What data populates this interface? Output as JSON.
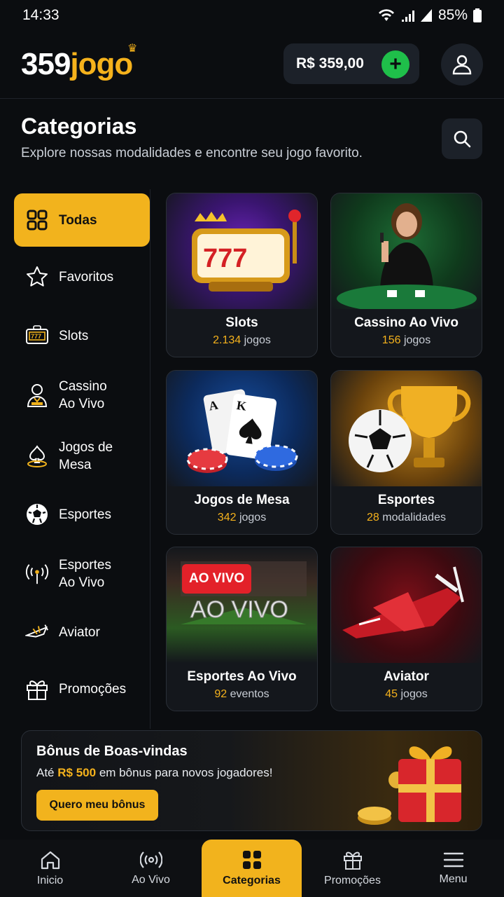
{
  "status": {
    "time": "14:33",
    "battery": "85%"
  },
  "header": {
    "logo_num": "359",
    "logo_word": "jogo",
    "balance": "R$ 359,00"
  },
  "page": {
    "title": "Categorias",
    "subtitle": "Explore nossas modalidades e encontre seu jogo favorito."
  },
  "sidebar": {
    "items": [
      {
        "label": "Todas",
        "icon": "grid-icon"
      },
      {
        "label": "Favoritos",
        "icon": "star-icon"
      },
      {
        "label": "Slots",
        "icon": "slot-machine-icon"
      },
      {
        "label": "Cassino\nAo Vivo",
        "icon": "dealer-icon"
      },
      {
        "label": "Jogos de\nMesa",
        "icon": "spade-chip-icon"
      },
      {
        "label": "Esportes",
        "icon": "soccer-ball-icon"
      },
      {
        "label": "Esportes\nAo Vivo",
        "icon": "broadcast-icon"
      },
      {
        "label": "Aviator",
        "icon": "plane-icon"
      },
      {
        "label": "Promoções",
        "icon": "gift-icon"
      }
    ]
  },
  "cards": [
    {
      "name": "Slots",
      "count": "2.134",
      "unit": "jogos"
    },
    {
      "name": "Cassino Ao Vivo",
      "count": "156",
      "unit": "jogos"
    },
    {
      "name": "Jogos de Mesa",
      "count": "342",
      "unit": "jogos"
    },
    {
      "name": "Esportes",
      "count": "28",
      "unit": "modalidades"
    },
    {
      "name": "Esportes Ao Vivo",
      "count": "92",
      "unit": "eventos",
      "badge": "AO VIVO",
      "art_text": "AO VIVO"
    },
    {
      "name": "Aviator",
      "count": "45",
      "unit": "jogos"
    }
  ],
  "bonus": {
    "title": "Bônus de Boas-vindas",
    "desc_prefix": "Até",
    "amount": "R$ 500",
    "desc_suffix": "em bônus para novos jogadores!",
    "cta": "Quero meu bônus"
  },
  "nav": {
    "items": [
      {
        "label": "Inicio",
        "icon": "home-icon"
      },
      {
        "label": "Ao Vivo",
        "icon": "broadcast-icon"
      },
      {
        "label": "Categorias",
        "icon": "grid-icon"
      },
      {
        "label": "Promoções",
        "icon": "gift-icon"
      },
      {
        "label": "Menu",
        "icon": "menu-icon"
      }
    ]
  },
  "colors": {
    "accent": "#f2b31d",
    "background": "#0b0d10",
    "green": "#1fbf4a",
    "live_red": "#e32129"
  }
}
